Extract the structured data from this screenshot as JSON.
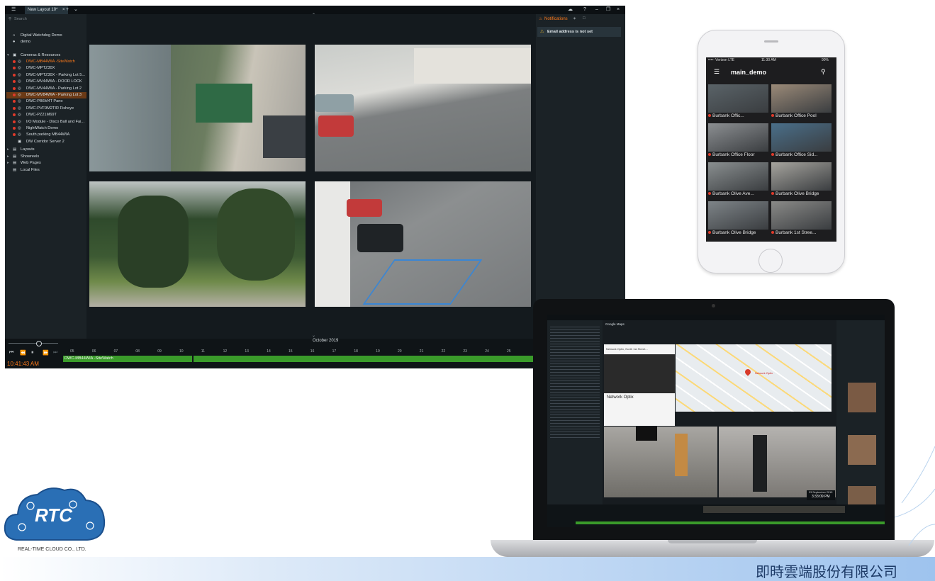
{
  "vms": {
    "tab_label": "New Layout 10*",
    "search_placeholder": "Search",
    "site_name": "Digital Watchdog Demo",
    "user_name": "demo",
    "tree_root": "Cameras & Resources",
    "cameras": [
      {
        "label": "DWC-MB44WIA -SiteWatch",
        "state": "active"
      },
      {
        "label": "DWC-MPTZ30X",
        "state": "normal"
      },
      {
        "label": "DWC-MPTZ30X - Parking Lot 5...",
        "state": "normal"
      },
      {
        "label": "DWC-MV44WIA - DOOR LOCK",
        "state": "normal"
      },
      {
        "label": "DWC-MV44WIA - Parking Lot 2",
        "state": "normal"
      },
      {
        "label": "DWC-MV84WIA - Parking Lot 3",
        "state": "selected"
      },
      {
        "label": "DWC-PB6M4T Pano",
        "state": "normal"
      },
      {
        "label": "DWC-PVF9M2TIR Fisheye",
        "state": "normal"
      },
      {
        "label": "DWC-PZ21M69T",
        "state": "normal"
      },
      {
        "label": "I/O Module - Disco Ball and Fai...",
        "state": "normal"
      },
      {
        "label": "NightWatch Demo",
        "state": "normal"
      },
      {
        "label": "South parking MB44WIA",
        "state": "normal"
      },
      {
        "label": "DW Corridor Server 2",
        "state": "normal"
      }
    ],
    "groups": [
      "Layouts",
      "Showreels",
      "Web Pages",
      "Local Files"
    ],
    "notifications_tab": "Notifications",
    "alert_text": "Email address is not set",
    "timeline_month": "October 2019",
    "timeline_ticks": [
      "05",
      "06",
      "07",
      "08",
      "09",
      "10",
      "11",
      "12",
      "13",
      "14",
      "15",
      "16",
      "17",
      "18",
      "19",
      "20",
      "21",
      "22",
      "23",
      "24",
      "25"
    ],
    "current_time": "10:41:43 AM",
    "track_label": "DWC-MB44WIA -SiteWatch"
  },
  "phone": {
    "carrier": "••••◦ Verizon  LTE",
    "clock": "11:30 AM",
    "battery": "90%",
    "title": "main_demo",
    "cameras": [
      "Burbank Offic...",
      "Burbank Office Pool",
      "Burbank Office Floor",
      "Burbank Office Sid...",
      "Burbank Olive Ave...",
      "Burbank Olive Bridge",
      "Burbank Olive Bridge",
      "Burbank 1st Stree..."
    ]
  },
  "laptop": {
    "map_tab": "Google Maps",
    "map_search": "Network Optix, North 1st Street...",
    "place_name": "Network Optix",
    "marker_label": "Network Optix",
    "date_label": "23 September 2019",
    "time_label": "3:33:09 PM"
  },
  "company": {
    "logo_text": "RTC",
    "logo_sub": "REAL-TIME CLOUD CO., LTD.",
    "name_zh": "即時雲端股份有限公司"
  },
  "colors": {
    "accent_orange": "#ff7a1a",
    "timeline_green": "#3a9b2a",
    "alert_yellow": "#e2b227",
    "logo_blue": "#2a6fb5"
  }
}
